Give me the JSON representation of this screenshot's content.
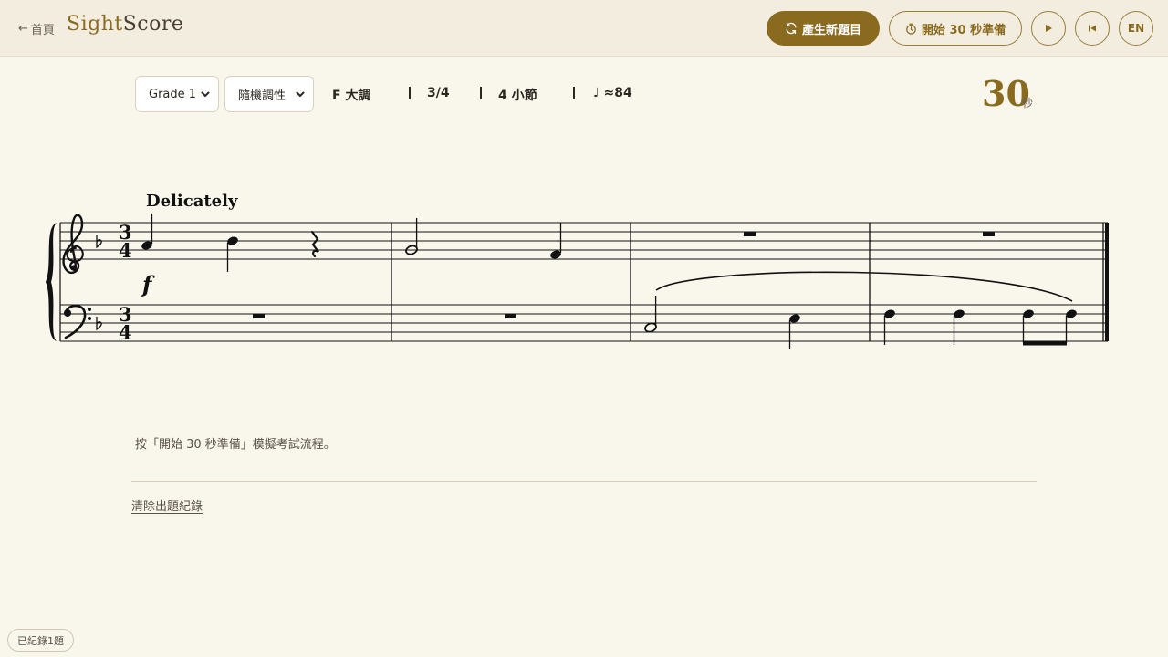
{
  "header": {
    "back_arrow": "←",
    "back_label": "首頁",
    "brand_part1": "Sight",
    "brand_part2": "Score",
    "generate_label": "產生新題目",
    "prepare_label": "開始 30 秒準備",
    "language_label": "EN",
    "icons": {
      "generate": "refresh-icon",
      "prepare": "timer-icon",
      "play": "play-icon",
      "restart": "skip-back-icon"
    }
  },
  "controls": {
    "grade_value": "Grade 1",
    "key_mode_value": "隨機調性",
    "key": "F 大調",
    "time_signature": "3/4",
    "measures": "4 小節",
    "tempo": "♩ ≈84"
  },
  "timer": {
    "value": "30",
    "unit": "秒"
  },
  "score": {
    "tempo_text": "Delicately",
    "dynamic": "f",
    "time_top": "3",
    "time_bottom": "4"
  },
  "hint_text": "按「開始 30 秒準備」模擬考試流程。",
  "clear_history_label": "清除出題紀錄",
  "history_badge": "已紀錄1題",
  "colors": {
    "accent": "#8a6a1f",
    "background": "#f9f6ec",
    "header_bg": "#f3ede0"
  }
}
